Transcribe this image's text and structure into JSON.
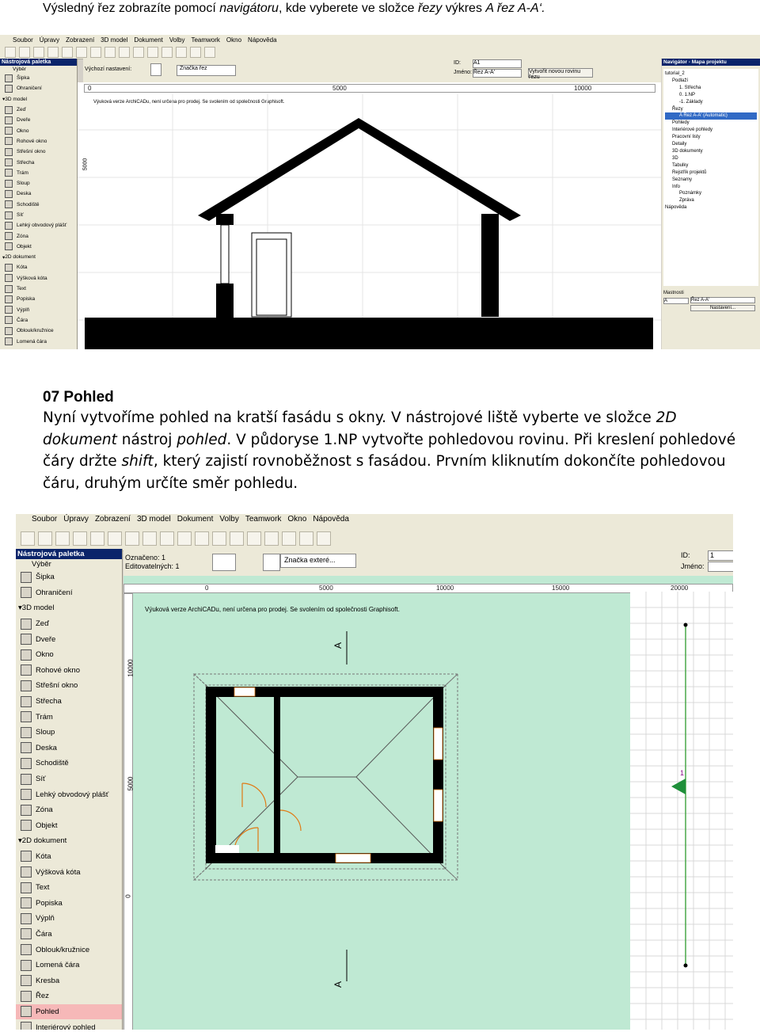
{
  "caption": {
    "prefix": "Výsledný řez zobrazíte pomocí ",
    "nav": "navigátoru",
    "mid1": ", kde vyberete ve složce ",
    "folder": "řezy",
    "mid2": " výkres ",
    "drawing": "A řez A-A‘."
  },
  "section": {
    "heading": "07 Pohled",
    "p1": "Nyní vytvoříme pohled na kratší fasádu s okny. V nástrojové liště vyberte ve složce ",
    "p1_em": "2D dokument",
    "p2": " nástroj ",
    "p2_em": "pohled",
    "p3": ". V půdoryse 1.NP vytvořte pohledovou rovinu. Při kreslení pohledové čáry držte ",
    "p3_em": "shift",
    "p4": ", který zajistí rovnoběžnost s fasádou. Prvním kliknutím dokončíte pohledovou čáru, druhým určíte směr pohledu."
  },
  "app": {
    "menu": [
      "Soubor",
      "Úpravy",
      "Zobrazení",
      "3D model",
      "Dokument",
      "Volby",
      "Teamwork",
      "Okno",
      "Nápověda"
    ],
    "palette_title": "Nástrojová paletka",
    "palette_items_top": [
      "Výběr"
    ],
    "palette_tools_shot1": [
      "Šipka",
      "Ohraničení",
      "3D model",
      "Zeď",
      "Dveře",
      "Okno",
      "Rohové okno",
      "Střešní okno",
      "Střecha",
      "Trám",
      "Sloup",
      "Deska",
      "Schodiště",
      "Síť",
      "Lehký obvodový plášť",
      "Zóna",
      "Objekt",
      "2D dokument",
      "Kóta",
      "Výšková kóta",
      "Text",
      "Popiska",
      "Výplň",
      "Čára",
      "Oblouk/kružnice",
      "Lomená čára"
    ],
    "palette_tools_shot2": [
      "Šipka",
      "Ohraničení",
      "3D model",
      "Zeď",
      "Dveře",
      "Okno",
      "Rohové okno",
      "Střešní okno",
      "Střecha",
      "Trám",
      "Sloup",
      "Deska",
      "Schodiště",
      "Síť",
      "Lehký obvodový plášť",
      "Zóna",
      "Objekt",
      "2D dokument",
      "Kóta",
      "Výšková kóta",
      "Text",
      "Popiska",
      "Výplň",
      "Čára",
      "Oblouk/kružnice",
      "Lomená čára",
      "Kresba",
      "Řez",
      "Pohled",
      "Interiérový pohled"
    ],
    "shot1": {
      "info_label": "Výchozí nastavení:",
      "marker": "Značka řez",
      "id_label": "ID:",
      "id_value": "A1",
      "name_label": "Jméno:",
      "name_value": "Řez A-A'",
      "create_btn": "Vytvořit novou rovinu řezu",
      "ruler": [
        "0",
        "5000",
        "10000",
        "5000"
      ],
      "watermark": "Výuková verze ArchiCADu, není určena pro prodej. Se svolením od společnosti Graphisoft.",
      "navigator_title": "Navigátor - Mapa projektu",
      "tree": [
        "tutorial_2",
        "Podlaží",
        "1. Střecha",
        "0. 1.NP",
        "-1. Základy",
        "Řezy",
        "A Řez A-A' (Automatic)",
        "Pohledy",
        "Interiérové pohledy",
        "Pracovní listy",
        "Detaily",
        "3D dokumenty",
        "3D",
        "Tabulky",
        "Rejstřík projektů",
        "Seznamy",
        "Info",
        "Poznámky",
        "Zpráva",
        "Nápověda"
      ],
      "props_title": "Mastnosti",
      "props_id": "A",
      "props_name": "Řez A-A'",
      "props_btn": "Nastavení..."
    },
    "shot2": {
      "info_sel": "Označeno: 1",
      "info_edit": "Editovatelných: 1",
      "marker": "Značka exteré...",
      "id_label": "ID:",
      "id_value": "1",
      "name_label": "Jméno:",
      "ruler": [
        "0",
        "5000",
        "10000",
        "15000",
        "20000"
      ],
      "vruler": [
        "10000",
        "5000",
        "0"
      ],
      "watermark": "Výuková verze ArchiCADu, není určena pro prodej. Se svolením od společnosti Graphisoft.",
      "section_letter": "A"
    }
  },
  "colors": {
    "plan_bg": "#bfe9d3",
    "palette_bg": "#ece9d8",
    "title_bar": "#0a246a",
    "selected_tool": "#f6b8b8",
    "view_line": "#4aa84a",
    "door": "#e07a14"
  }
}
